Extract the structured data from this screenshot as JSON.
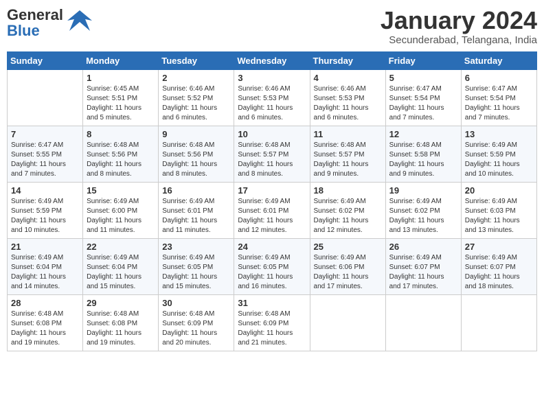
{
  "logo": {
    "general": "General",
    "blue": "Blue"
  },
  "title": "January 2024",
  "location": "Secunderabad, Telangana, India",
  "days_of_week": [
    "Sunday",
    "Monday",
    "Tuesday",
    "Wednesday",
    "Thursday",
    "Friday",
    "Saturday"
  ],
  "weeks": [
    [
      {
        "day": "",
        "content": ""
      },
      {
        "day": "1",
        "content": "Sunrise: 6:45 AM\nSunset: 5:51 PM\nDaylight: 11 hours\nand 5 minutes."
      },
      {
        "day": "2",
        "content": "Sunrise: 6:46 AM\nSunset: 5:52 PM\nDaylight: 11 hours\nand 6 minutes."
      },
      {
        "day": "3",
        "content": "Sunrise: 6:46 AM\nSunset: 5:53 PM\nDaylight: 11 hours\nand 6 minutes."
      },
      {
        "day": "4",
        "content": "Sunrise: 6:46 AM\nSunset: 5:53 PM\nDaylight: 11 hours\nand 6 minutes."
      },
      {
        "day": "5",
        "content": "Sunrise: 6:47 AM\nSunset: 5:54 PM\nDaylight: 11 hours\nand 7 minutes."
      },
      {
        "day": "6",
        "content": "Sunrise: 6:47 AM\nSunset: 5:54 PM\nDaylight: 11 hours\nand 7 minutes."
      }
    ],
    [
      {
        "day": "7",
        "content": "Sunrise: 6:47 AM\nSunset: 5:55 PM\nDaylight: 11 hours\nand 7 minutes."
      },
      {
        "day": "8",
        "content": "Sunrise: 6:48 AM\nSunset: 5:56 PM\nDaylight: 11 hours\nand 8 minutes."
      },
      {
        "day": "9",
        "content": "Sunrise: 6:48 AM\nSunset: 5:56 PM\nDaylight: 11 hours\nand 8 minutes."
      },
      {
        "day": "10",
        "content": "Sunrise: 6:48 AM\nSunset: 5:57 PM\nDaylight: 11 hours\nand 8 minutes."
      },
      {
        "day": "11",
        "content": "Sunrise: 6:48 AM\nSunset: 5:57 PM\nDaylight: 11 hours\nand 9 minutes."
      },
      {
        "day": "12",
        "content": "Sunrise: 6:48 AM\nSunset: 5:58 PM\nDaylight: 11 hours\nand 9 minutes."
      },
      {
        "day": "13",
        "content": "Sunrise: 6:49 AM\nSunset: 5:59 PM\nDaylight: 11 hours\nand 10 minutes."
      }
    ],
    [
      {
        "day": "14",
        "content": "Sunrise: 6:49 AM\nSunset: 5:59 PM\nDaylight: 11 hours\nand 10 minutes."
      },
      {
        "day": "15",
        "content": "Sunrise: 6:49 AM\nSunset: 6:00 PM\nDaylight: 11 hours\nand 11 minutes."
      },
      {
        "day": "16",
        "content": "Sunrise: 6:49 AM\nSunset: 6:01 PM\nDaylight: 11 hours\nand 11 minutes."
      },
      {
        "day": "17",
        "content": "Sunrise: 6:49 AM\nSunset: 6:01 PM\nDaylight: 11 hours\nand 12 minutes."
      },
      {
        "day": "18",
        "content": "Sunrise: 6:49 AM\nSunset: 6:02 PM\nDaylight: 11 hours\nand 12 minutes."
      },
      {
        "day": "19",
        "content": "Sunrise: 6:49 AM\nSunset: 6:02 PM\nDaylight: 11 hours\nand 13 minutes."
      },
      {
        "day": "20",
        "content": "Sunrise: 6:49 AM\nSunset: 6:03 PM\nDaylight: 11 hours\nand 13 minutes."
      }
    ],
    [
      {
        "day": "21",
        "content": "Sunrise: 6:49 AM\nSunset: 6:04 PM\nDaylight: 11 hours\nand 14 minutes."
      },
      {
        "day": "22",
        "content": "Sunrise: 6:49 AM\nSunset: 6:04 PM\nDaylight: 11 hours\nand 15 minutes."
      },
      {
        "day": "23",
        "content": "Sunrise: 6:49 AM\nSunset: 6:05 PM\nDaylight: 11 hours\nand 15 minutes."
      },
      {
        "day": "24",
        "content": "Sunrise: 6:49 AM\nSunset: 6:05 PM\nDaylight: 11 hours\nand 16 minutes."
      },
      {
        "day": "25",
        "content": "Sunrise: 6:49 AM\nSunset: 6:06 PM\nDaylight: 11 hours\nand 17 minutes."
      },
      {
        "day": "26",
        "content": "Sunrise: 6:49 AM\nSunset: 6:07 PM\nDaylight: 11 hours\nand 17 minutes."
      },
      {
        "day": "27",
        "content": "Sunrise: 6:49 AM\nSunset: 6:07 PM\nDaylight: 11 hours\nand 18 minutes."
      }
    ],
    [
      {
        "day": "28",
        "content": "Sunrise: 6:48 AM\nSunset: 6:08 PM\nDaylight: 11 hours\nand 19 minutes."
      },
      {
        "day": "29",
        "content": "Sunrise: 6:48 AM\nSunset: 6:08 PM\nDaylight: 11 hours\nand 19 minutes."
      },
      {
        "day": "30",
        "content": "Sunrise: 6:48 AM\nSunset: 6:09 PM\nDaylight: 11 hours\nand 20 minutes."
      },
      {
        "day": "31",
        "content": "Sunrise: 6:48 AM\nSunset: 6:09 PM\nDaylight: 11 hours\nand 21 minutes."
      },
      {
        "day": "",
        "content": ""
      },
      {
        "day": "",
        "content": ""
      },
      {
        "day": "",
        "content": ""
      }
    ]
  ]
}
